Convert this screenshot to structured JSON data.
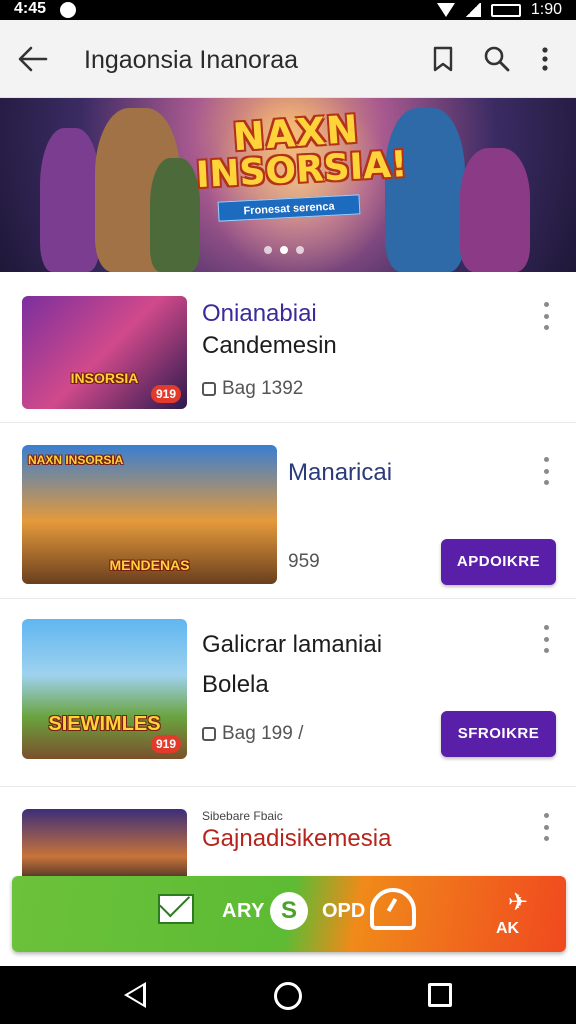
{
  "status_bar": {
    "time": "4:45",
    "clock_right": "1:90"
  },
  "app_bar": {
    "title": "Ingaonsia Inanoraa",
    "icons": [
      "back-arrow-icon",
      "bookmark-icon",
      "search-icon",
      "more-vert-icon"
    ]
  },
  "banner": {
    "logo_line1": "NAXN",
    "logo_line2": "INSORSIA!",
    "subtitle": "Fronesat serenca",
    "slides": 3,
    "active_slide": 2
  },
  "cards": [
    {
      "title": "Onianabiai",
      "subtitle": "Candemesin",
      "meta": "Bag 1392",
      "thumb_text": "INSORSIA",
      "badge": "919",
      "title_color": "#3a2a9b"
    },
    {
      "title": "Manaricai",
      "subtitle": "",
      "meta": "959",
      "thumb_text": "MENDENAS",
      "thumb_top_text": "NAXN INSORSIA",
      "button": "APDOIKRE",
      "title_color": "#2b3a7a"
    },
    {
      "title": "Galicrar lamaniai",
      "subtitle": "Bolela",
      "meta": "Bag 199 /",
      "thumb_text": "SIEWIMLES",
      "badge": "919",
      "button": "SFROIKRE",
      "title_color": "#1d1d1d"
    },
    {
      "title": "Gajnadisikemesia",
      "overline": "Sibebare Fbaic",
      "subtitle": "",
      "meta": "",
      "thumb_text": "",
      "title_color": "#b5251d"
    }
  ],
  "promo": {
    "label_left": "ARY",
    "center_glyph": "S",
    "label_right": "OPD",
    "right_label": "AK",
    "right_glyph": "✈"
  },
  "colors": {
    "accent": "#5a1fa8",
    "promo_green": "#6cc23a",
    "promo_red": "#f0491f"
  }
}
